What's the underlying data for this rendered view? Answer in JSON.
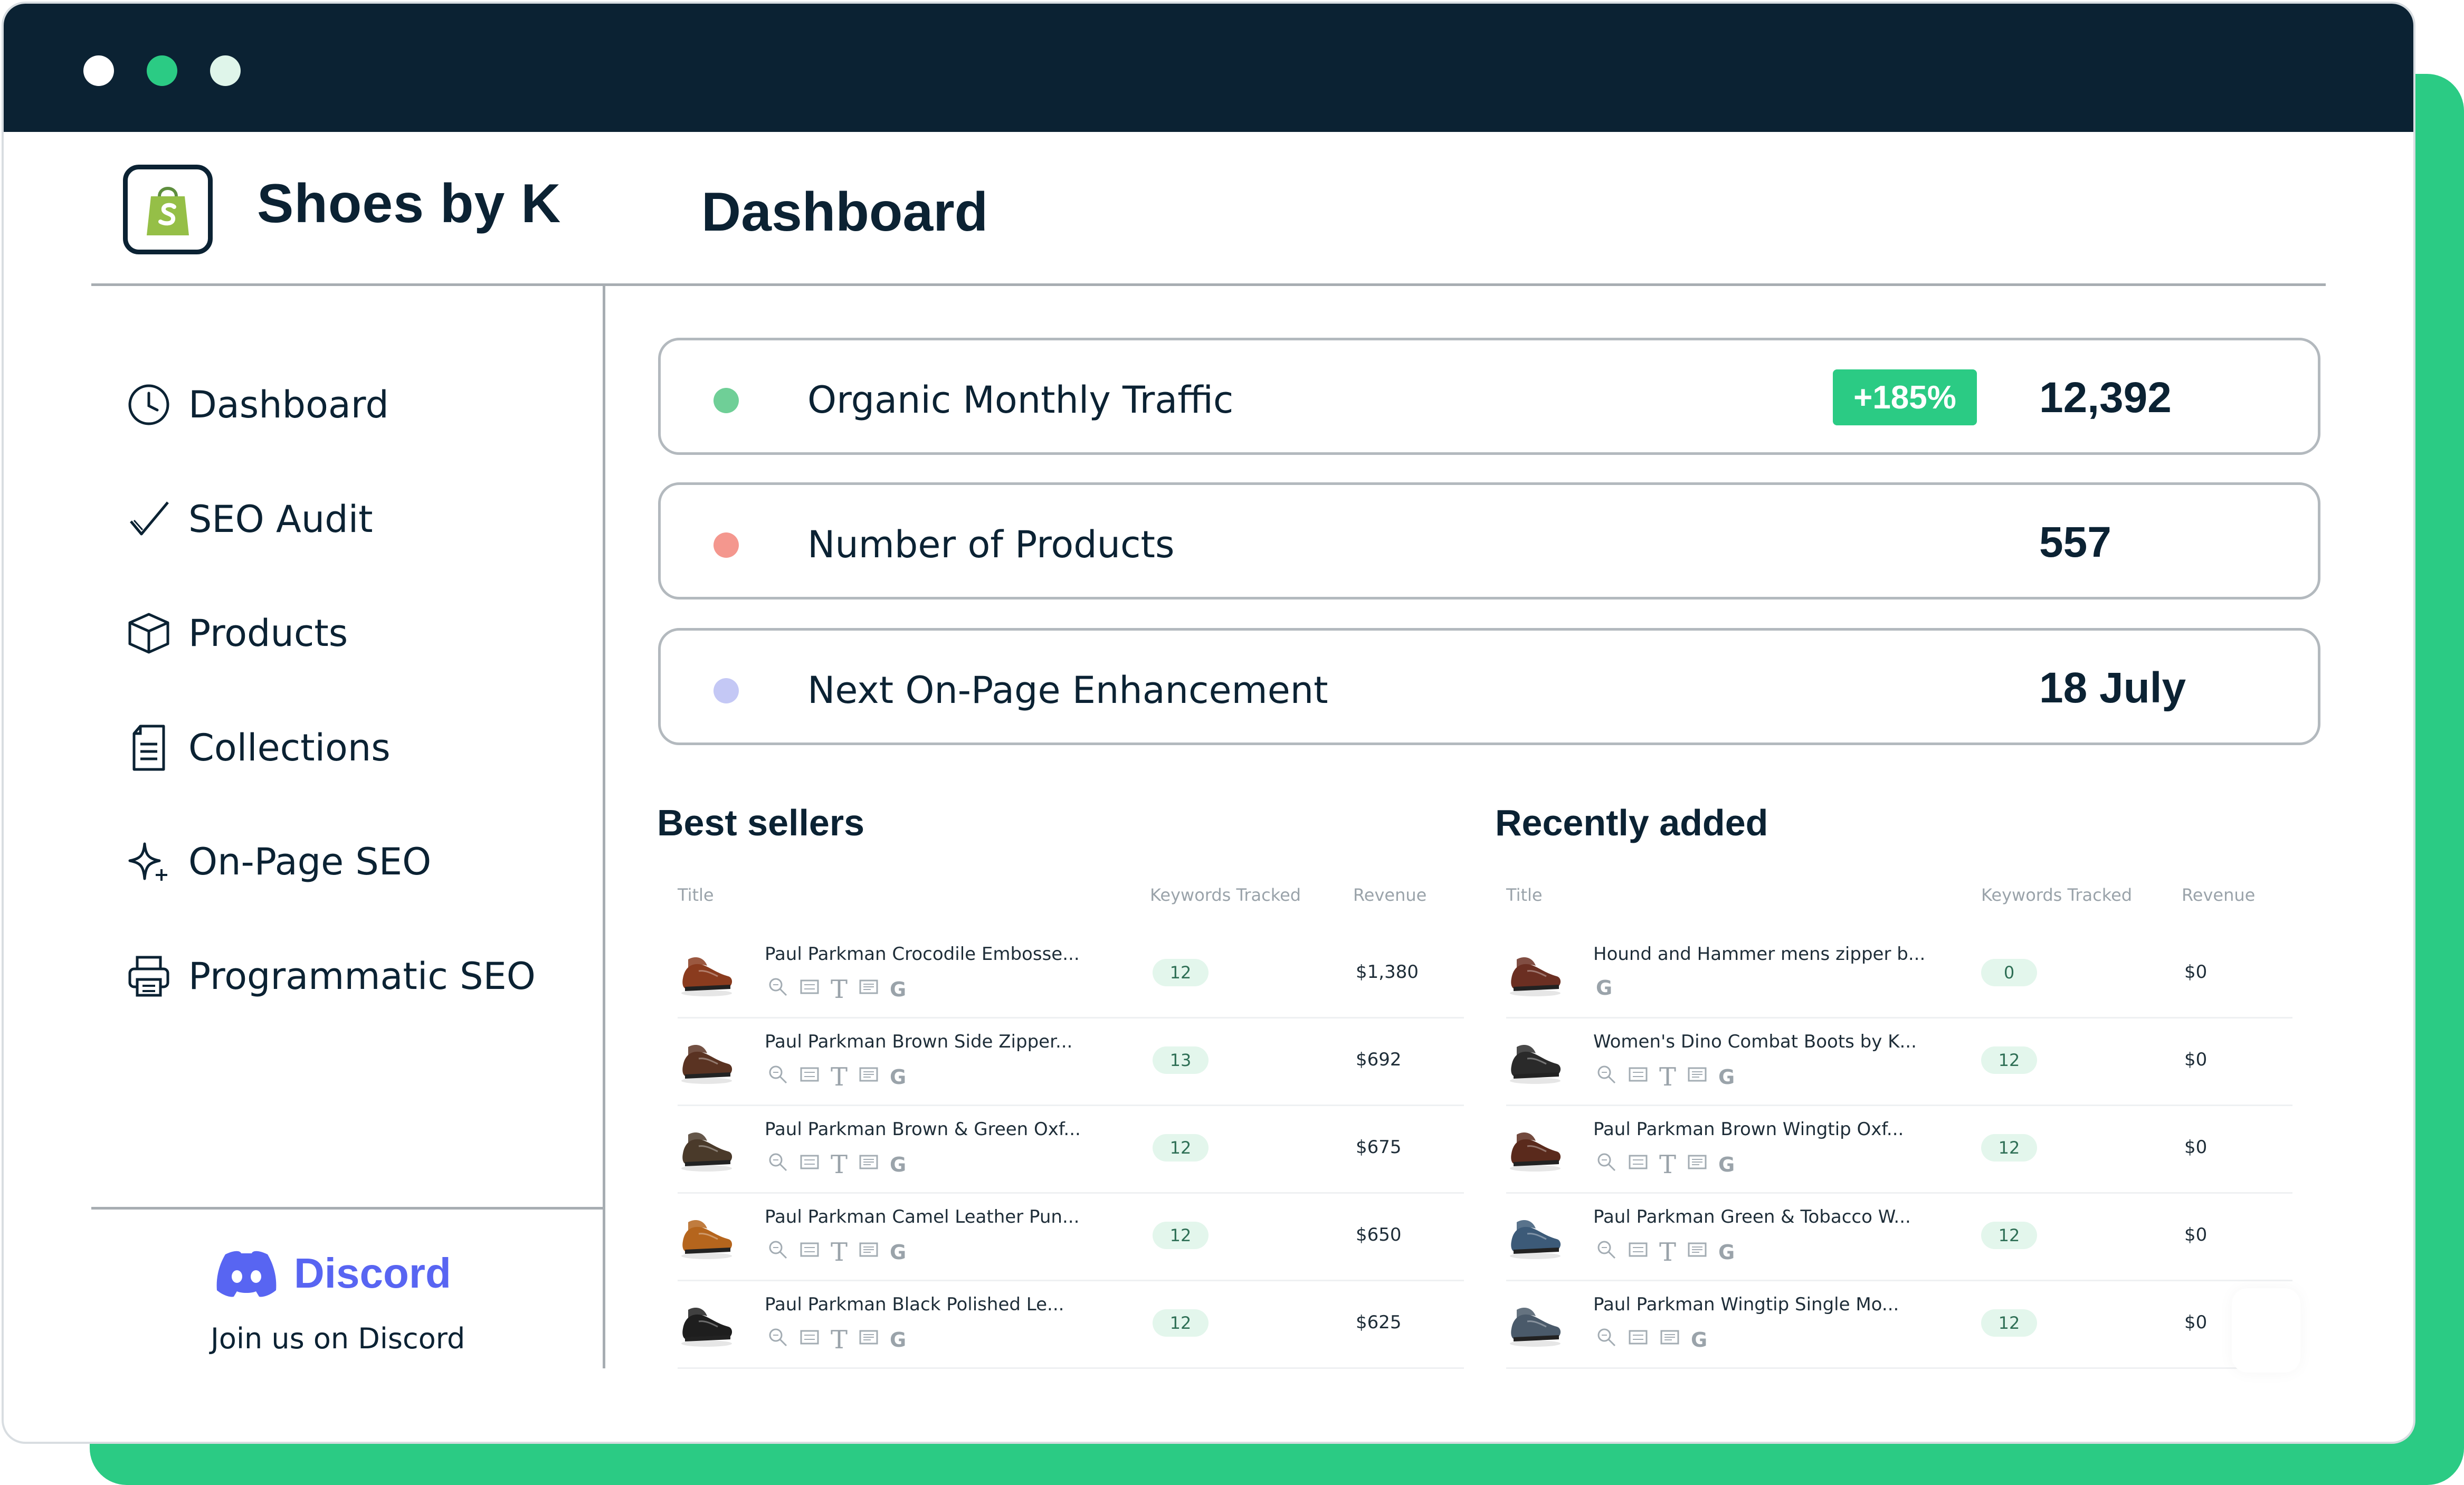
{
  "brand": {
    "name": "Shoes by K"
  },
  "page": {
    "title": "Dashboard"
  },
  "sidebar": {
    "items": [
      {
        "label": "Dashboard",
        "icon": "clock-icon"
      },
      {
        "label": "SEO Audit",
        "icon": "checkmark-icon"
      },
      {
        "label": "Products",
        "icon": "box-icon"
      },
      {
        "label": "Collections",
        "icon": "document-icon"
      },
      {
        "label": "On-Page SEO",
        "icon": "sparkle-icon"
      },
      {
        "label": "Programmatic SEO",
        "icon": "printer-icon"
      }
    ],
    "discord": {
      "name": "Discord",
      "join_text": "Join us on Discord"
    }
  },
  "cards": [
    {
      "label": "Organic Monthly Traffic",
      "badge": "+185%",
      "value": "12,392",
      "dot_color": "#6fcf97"
    },
    {
      "label": "Number of Products",
      "value": "557",
      "dot_color": "#f4978e"
    },
    {
      "label": "Next On-Page Enhancement",
      "value": "18 July",
      "dot_color": "#c4c8f5"
    }
  ],
  "best_sellers": {
    "title": "Best sellers",
    "columns": {
      "title": "Title",
      "keywords": "Keywords Tracked",
      "revenue": "Revenue"
    },
    "rows": [
      {
        "title": "Paul Parkman Crocodile Embosse...",
        "keywords": "12",
        "revenue": "$1,380",
        "shoe_color": "#8a3b1e"
      },
      {
        "title": "Paul Parkman Brown Side Zipper...",
        "keywords": "13",
        "revenue": "$692",
        "shoe_color": "#5a3322"
      },
      {
        "title": "Paul Parkman Brown & Green Oxf...",
        "keywords": "12",
        "revenue": "$675",
        "shoe_color": "#4a3a2a"
      },
      {
        "title": "Paul Parkman Camel Leather Pun...",
        "keywords": "12",
        "revenue": "$650",
        "shoe_color": "#b5651d"
      },
      {
        "title": "Paul Parkman Black Polished Le...",
        "keywords": "12",
        "revenue": "$625",
        "shoe_color": "#1e1e1e"
      }
    ]
  },
  "recently_added": {
    "title": "Recently added",
    "columns": {
      "title": "Title",
      "keywords": "Keywords Tracked",
      "revenue": "Revenue"
    },
    "rows": [
      {
        "title": "Hound and Hammer mens zipper b...",
        "keywords": "0",
        "revenue": "$0",
        "shoe_color": "#6b2f22"
      },
      {
        "title": "Women's Dino Combat Boots by K...",
        "keywords": "12",
        "revenue": "$0",
        "shoe_color": "#2a2a2a"
      },
      {
        "title": "Paul Parkman Brown Wingtip Oxf...",
        "keywords": "12",
        "revenue": "$0",
        "shoe_color": "#5a2a1c"
      },
      {
        "title": "Paul Parkman Green & Tobacco W...",
        "keywords": "12",
        "revenue": "$0",
        "shoe_color": "#3c5a78"
      },
      {
        "title": "Paul Parkman Wingtip Single Mo...",
        "keywords": "12",
        "revenue": "$0",
        "shoe_color": "#4a5a6a"
      }
    ]
  },
  "seo_icons": [
    "search-icon",
    "meta-icon",
    "text-icon",
    "description-icon",
    "google-icon"
  ],
  "seo_glyphs": {
    "text": "T",
    "google": "G"
  },
  "colors": {
    "accent": "#2bcb84",
    "dark": "#0b2233",
    "discord": "#5865f2"
  }
}
